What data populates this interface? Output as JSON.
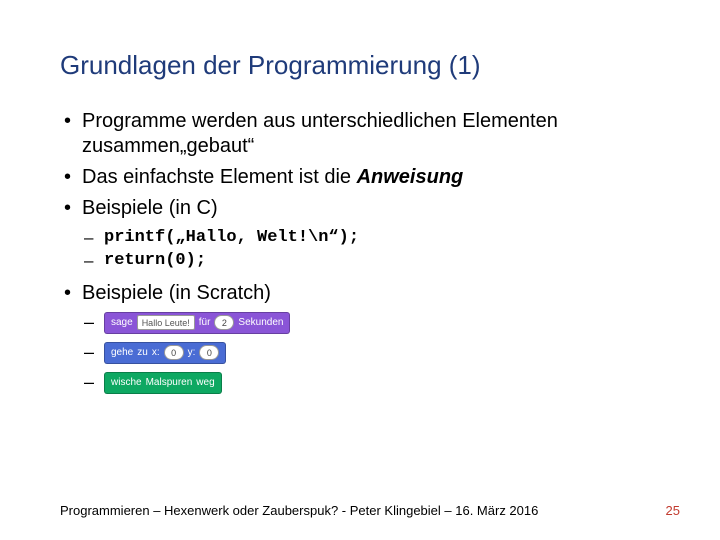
{
  "title": "Grundlagen der Programmierung (1)",
  "bullets": {
    "b1": "Programme werden aus unterschiedlichen Elementen zusammen„gebaut“",
    "b2_pre": "Das einfachste Element ist die ",
    "b2_em": "Anweisung",
    "b3": "Beispiele (in C)",
    "b4": "Beispiele (in Scratch)"
  },
  "code": {
    "c1": "printf(„Hallo, Welt!\\n“);",
    "c2": "return(0);"
  },
  "scratch": {
    "s1": {
      "sage": "sage",
      "text": "Hallo Leute!",
      "fur": "für",
      "num": "2",
      "sek": "Sekunden"
    },
    "s2": {
      "gehe": "gehe",
      "zu": "zu",
      "x": "x:",
      "xv": "0",
      "y": "y:",
      "yv": "0"
    },
    "s3": {
      "wische": "wische",
      "mal": "Malspuren",
      "weg": "weg"
    }
  },
  "footer": {
    "text": "Programmieren – Hexenwerk oder Zauberspuk? - Peter Klingebiel – 16. März 2016",
    "page": "25"
  }
}
